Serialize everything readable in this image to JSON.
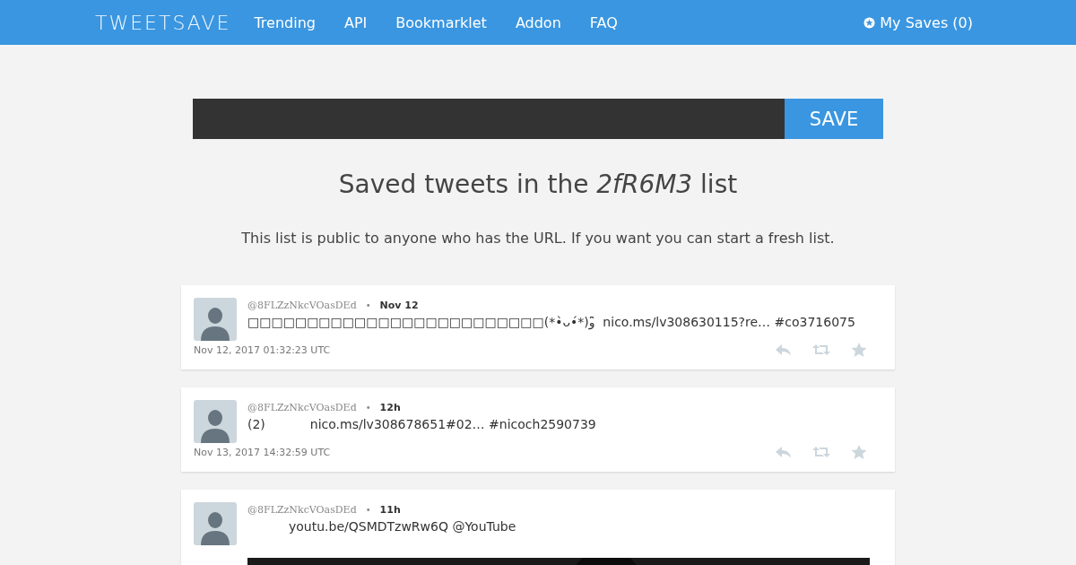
{
  "nav": {
    "logo": "TWEETSAVE",
    "links": [
      "Trending",
      "API",
      "Bookmarklet",
      "Addon",
      "FAQ"
    ],
    "saves": "My Saves (0)"
  },
  "save_form": {
    "button": "SAVE"
  },
  "heading": {
    "before": "Saved tweets in the",
    "list_name": "2fR6M3",
    "after": "list"
  },
  "separator": "•",
  "notice": "This list is public to anyone who has the URL. If you want you can start a fresh list.",
  "tweets": [
    {
      "handle": "@8FLZzNkcVOasDEd",
      "time": "Nov 12",
      "body": [
        "□□□□□□□□□□□□□□□□□□□□□□□□□(*•̀ᴗ•́*)و ̑̑ nico.ms/lv308630115?re… #co3716075"
      ],
      "indented": false,
      "timestamp": "Nov 12, 2017 01:32:23 UTC",
      "has_media": false
    },
    {
      "handle": "@8FLZzNkcVOasDEd",
      "time": "12h",
      "body": [
        "(2)",
        "nico.ms/lv308678651#02… #nicoch2590739"
      ],
      "indented": false,
      "timestamp": "Nov 13, 2017 14:32:59 UTC",
      "has_media": false
    },
    {
      "handle": "@8FLZzNkcVOasDEd",
      "time": "11h",
      "body": [
        "youtu.be/QSMDTzwRw6Q @YouTube"
      ],
      "indented": true,
      "has_media": true
    }
  ]
}
